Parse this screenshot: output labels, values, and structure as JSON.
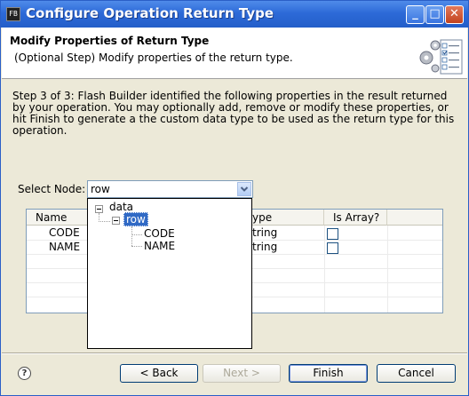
{
  "window": {
    "title": "Configure Operation Return Type",
    "app_icon_text": "FB",
    "controls": {
      "minimize": "_",
      "maximize": "□",
      "close": "✕"
    }
  },
  "header": {
    "title": "Modify Properties of Return Type",
    "description": "(Optional Step) Modify properties of the return type."
  },
  "body": {
    "instructions": "Step 3 of 3: Flash Builder identified the following properties in the result returned by your operation. You may optionally add, remove or modify these properties, or hit Finish to generate a the custom data type to be used as the return type for this operation."
  },
  "select_node": {
    "label": "Select Node:",
    "value": "row"
  },
  "tree": {
    "root": "data",
    "child": "row",
    "leaves": [
      "CODE",
      "NAME"
    ]
  },
  "table": {
    "columns": [
      "Name",
      "Type",
      "Is Array?"
    ],
    "visible_type_header": "ype",
    "rows": [
      {
        "name": "CODE",
        "type_visible": "tring",
        "is_array": false
      },
      {
        "name": "NAME",
        "type_visible": "tring",
        "is_array": false
      }
    ]
  },
  "buttons": {
    "help": "?",
    "back": "< Back",
    "next": "Next >",
    "finish": "Finish",
    "cancel": "Cancel"
  },
  "colors": {
    "titlebar": "#2d6ad8",
    "selection": "#316ac5",
    "dialog_bg": "#ece9d8"
  }
}
